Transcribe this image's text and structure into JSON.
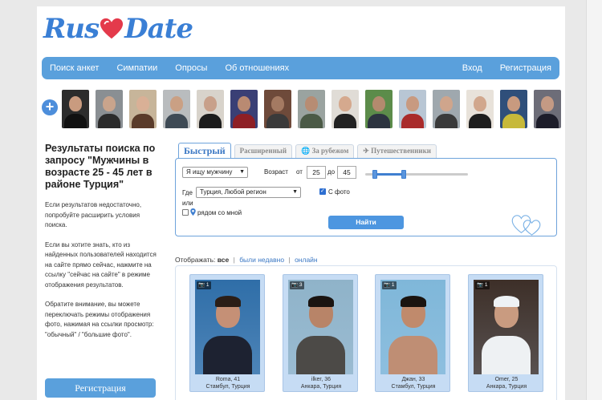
{
  "logo": {
    "part1": "Rus",
    "part2": "Date"
  },
  "nav": {
    "items": [
      "Поиск анкет",
      "Симпатии",
      "Опросы",
      "Об отношениях"
    ],
    "login": "Вход",
    "register": "Регистрация"
  },
  "thumbnails": {
    "add_symbol": "+",
    "tones": [
      {
        "bg": "#2c2c2c",
        "skin": "#c99b7f",
        "cloth": "#111111"
      },
      {
        "bg": "#8a8f93",
        "skin": "#c9a48c",
        "cloth": "#2b2b2b"
      },
      {
        "bg": "#c7b59a",
        "skin": "#d9b096",
        "cloth": "#5a3b2a"
      },
      {
        "bg": "#b9bcbe",
        "skin": "#caa084",
        "cloth": "#3e4a55"
      },
      {
        "bg": "#d8d3cb",
        "skin": "#c8a08a",
        "cloth": "#1c1c1c"
      },
      {
        "bg": "#3a3f75",
        "skin": "#b98a72",
        "cloth": "#8e1f25"
      },
      {
        "bg": "#6e4a3a",
        "skin": "#a47a62",
        "cloth": "#3a3a3a"
      },
      {
        "bg": "#9aa3a0",
        "skin": "#b78c73",
        "cloth": "#4b5a46"
      },
      {
        "bg": "#e0dcd6",
        "skin": "#d5a98e",
        "cloth": "#222222"
      },
      {
        "bg": "#5c8c4a",
        "skin": "#b38a6e",
        "cloth": "#2c3440"
      },
      {
        "bg": "#b8c6d4",
        "skin": "#c89a80",
        "cloth": "#a92b2b"
      },
      {
        "bg": "#9fa8ae",
        "skin": "#cfa58c",
        "cloth": "#3a3a3a"
      },
      {
        "bg": "#e8e2da",
        "skin": "#d1a78d",
        "cloth": "#1e1e1e"
      },
      {
        "bg": "#2f4f7a",
        "skin": "#c89a7f",
        "cloth": "#c7b93a"
      },
      {
        "bg": "#6d6d78",
        "skin": "#c49a84",
        "cloth": "#1d1d2a"
      }
    ]
  },
  "left": {
    "heading": "Результаты поиска по запросу \"Мужчины в возрасте 25 - 45 лет в районе Турция\"",
    "p1": "Если результатов недостаточно, попробуйте расширить условия поиска.",
    "p2": "Если вы хотите знать, кто из найденных пользователей находится на сайте прямо сейчас, нажмите на ссылку \"сейчас на сайте\" в режиме отображения результатов.",
    "p3": "Обратите внимание, вы можете переключать режимы отображения фото, нажимая на ссылки просмотр: \"обычный\" / \"большие фото\".",
    "register_button": "Регистрация"
  },
  "tabs": [
    "Быстрый",
    "Расширенный",
    "За рубежом",
    "Путешественники"
  ],
  "search": {
    "seeking": "Я ищу мужчину",
    "age_label": "Возраст",
    "from_label": "от",
    "age_from": "25",
    "to_label": "до",
    "age_to": "45",
    "where_label": "Где",
    "region": "Турция, Любой регион",
    "or_label": "или",
    "nearby_label": "рядом со мной",
    "photo_label": "С фото",
    "photo_checked": true,
    "find_button": "Найти"
  },
  "display": {
    "label": "Отображать:",
    "options": [
      "все",
      "были недавно",
      "онлайн"
    ],
    "current": "все"
  },
  "results": [
    {
      "photos": "1",
      "name": "Roma",
      "age": "41",
      "city": "Стамбул",
      "country": "Турция",
      "bg": "#2f6ea8",
      "skin": "#c59076",
      "hair": "#2b1e17",
      "cloth": "#1d2231"
    },
    {
      "photos": "3",
      "name": "ilker",
      "age": "36",
      "city": "Анкара",
      "country": "Турция",
      "bg": "#8fb3c9",
      "skin": "#b88468",
      "hair": "#1a1411",
      "cloth": "#4c4a47"
    },
    {
      "photos": "1",
      "name": "Джан",
      "age": "33",
      "city": "Стамбул",
      "country": "Турция",
      "bg": "#7fb7d9",
      "skin": "#c08a6c",
      "hair": "#1a1410",
      "cloth": "#bf8e74"
    },
    {
      "photos": "1",
      "name": "Omer",
      "age": "25",
      "city": "Анкара",
      "country": "Турция",
      "bg": "#3d2f28",
      "skin": "#c99b80",
      "hair": "#eef2f5",
      "cloth": "#eef1f3"
    }
  ],
  "colors": {
    "accent": "#5aa0dc",
    "heart": "#e43a4b",
    "link": "#3b78c4"
  }
}
